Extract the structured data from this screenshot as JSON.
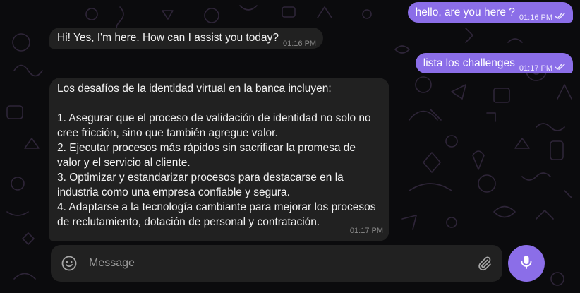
{
  "conversation": {
    "messages": [
      {
        "direction": "outgoing",
        "text": "hello, are you here ?",
        "time": "01:16 PM",
        "status": "read"
      },
      {
        "direction": "incoming",
        "text": "Hi! Yes, I'm here. How can I assist you today?",
        "time": "01:16 PM"
      },
      {
        "direction": "outgoing",
        "text": "lista los challenges",
        "time": "01:17 PM",
        "status": "read"
      },
      {
        "direction": "incoming",
        "text": "Los desafíos de la identidad virtual en la banca incluyen:\n\n1. Asegurar que el proceso de validación de identidad no solo no cree fricción, sino que también agregue valor.\n2. Ejecutar procesos más rápidos sin sacrificar la promesa de valor y el servicio al cliente.\n3. Optimizar y estandarizar procesos para destacarse en la industria como una empresa confiable y segura.\n4. Adaptarse a la tecnología cambiante para mejorar los procesos de reclutamiento, dotación de personal y contratación.",
        "time": "01:17 PM"
      }
    ]
  },
  "composer": {
    "placeholder": "Message",
    "value": "",
    "emoji_icon": "emoji-icon",
    "attach_icon": "paperclip-icon",
    "send_icon": "microphone-icon"
  },
  "theme": {
    "background": "#0b0b0d",
    "outgoing_bubble": "#8b6ee8",
    "incoming_bubble": "#212121",
    "accent": "#8b6ee8",
    "doodle_color": "#2e2538"
  }
}
